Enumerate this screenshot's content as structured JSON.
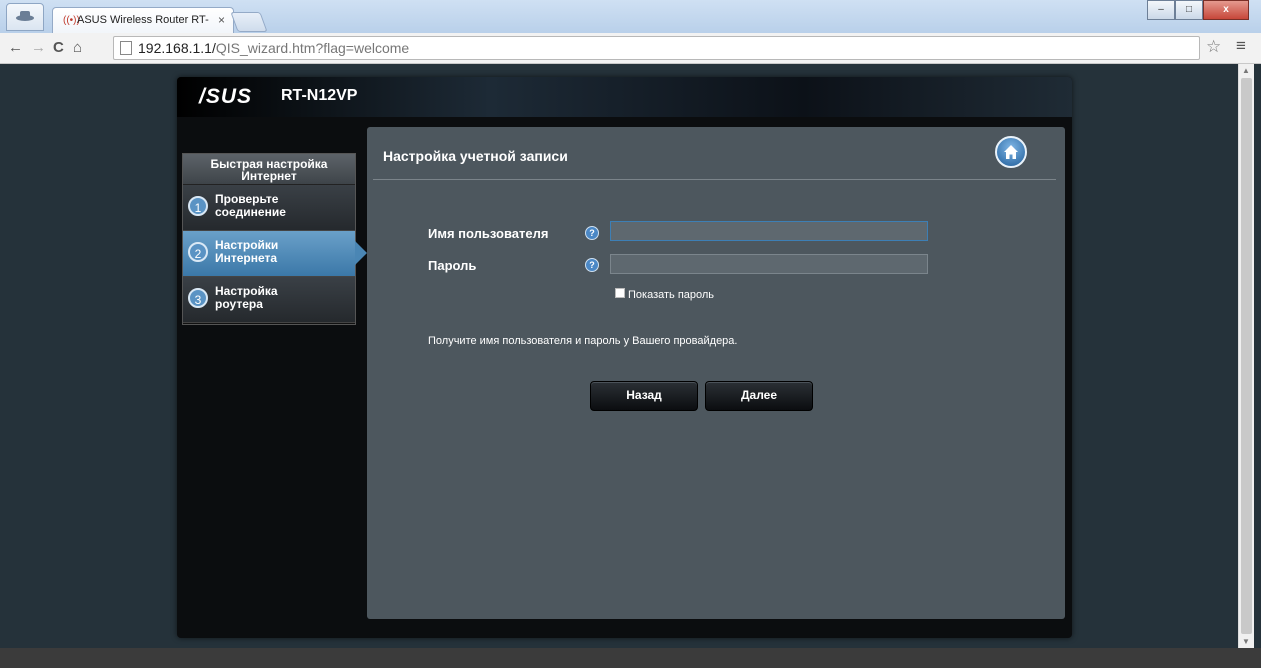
{
  "browser": {
    "tab_title": "ASUS Wireless Router RT-",
    "tab_close": "×",
    "url_host": "192.168.1.1/",
    "url_path": "QIS_wizard.htm?flag=welcome",
    "window_min": "–",
    "window_max": "□",
    "window_close": "x",
    "star_glyph": "☆",
    "menu_glyph": "≡"
  },
  "router": {
    "brand": "/SUS",
    "model": "RT-N12VP"
  },
  "sidebar": {
    "heading_line1": "Быстрая настройка",
    "heading_line2": "Интернет",
    "steps": [
      {
        "num": "1",
        "line1": "Проверьте",
        "line2": "соединение",
        "active": false
      },
      {
        "num": "2",
        "line1": "Настройки",
        "line2": "Интернета",
        "active": true
      },
      {
        "num": "3",
        "line1": "Настройка",
        "line2": "роутера",
        "active": false
      }
    ]
  },
  "page": {
    "title": "Настройка учетной записи",
    "username_label": "Имя пользователя",
    "username_value": "",
    "password_label": "Пароль",
    "password_value": "",
    "help_glyph": "?",
    "show_password_label": "Показать пароль",
    "hint": "Получите имя пользователя и пароль у Вашего провайдера.",
    "back_button": "Назад",
    "next_button": "Далее"
  },
  "colors": {
    "page_bg": "#25323a",
    "panel_bg": "#4d575e",
    "active_step": "#4a86b4",
    "help_icon": "#4b88c6"
  }
}
